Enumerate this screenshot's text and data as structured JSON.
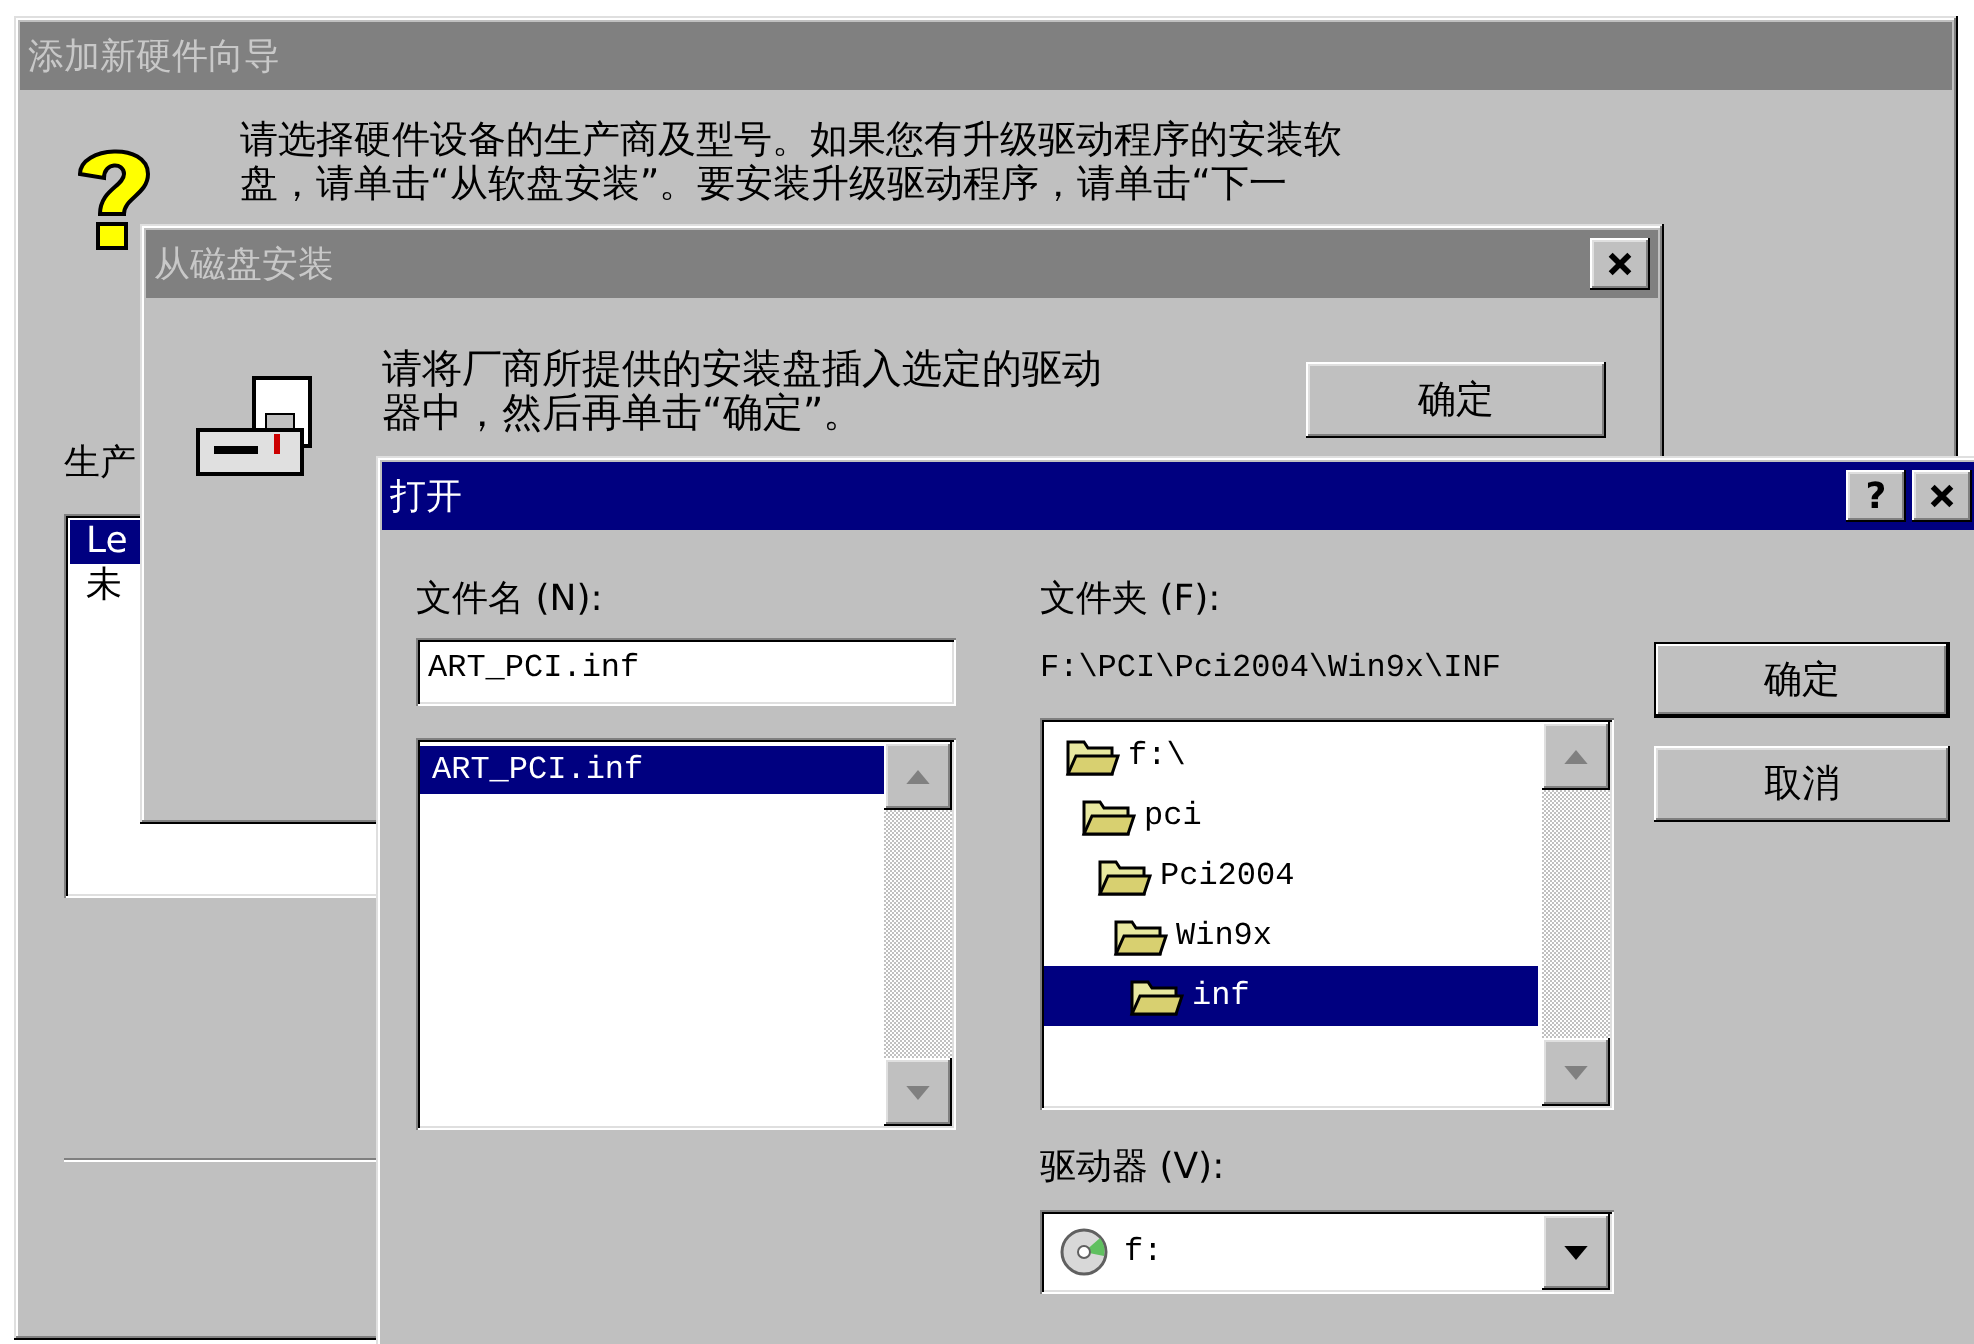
{
  "wizard": {
    "title": "添加新硬件向导",
    "active": false,
    "message": [
      "请选择硬件设备的生产商及型号。如果您有升级驱动程序的安装软",
      "盘，请单击“从软盘安装”。要安装升级驱动程序，请单击“下一"
    ],
    "manufacturer_label": "生产",
    "manufacturers": [
      {
        "label": "Le",
        "selected": true
      },
      {
        "label": "未",
        "selected": false
      }
    ]
  },
  "install_dialog": {
    "title": "从磁盘安装",
    "active": false,
    "message": [
      "请将厂商所提供的安装盘插入选定的驱动",
      "器中，然后再单击“确定”。"
    ],
    "ok_button": "确定"
  },
  "open_dialog": {
    "title": "打开",
    "active": true,
    "help_button": "?",
    "file_name_label": "文件名 (N):",
    "file_name": "ART_PCI.inf",
    "files": [
      {
        "label": "ART_PCI.inf",
        "selected": true
      }
    ],
    "folder_label": "文件夹 (F):",
    "folder_path": "F:\\PCI\\Pci2004\\Win9x\\INF",
    "folders": [
      {
        "label": "f:\\",
        "selected": false,
        "children": [
          {
            "label": "pci",
            "selected": false,
            "children": [
              {
                "label": "Pci2004",
                "selected": false,
                "children": [
                  {
                    "label": "Win9x",
                    "selected": false,
                    "children": [
                      {
                        "label": "inf",
                        "selected": true
                      }
                    ]
                  }
                ]
              }
            ]
          }
        ]
      }
    ],
    "drive_label": "驱动器 (V):",
    "drive": "f:",
    "buttons": [
      "确定",
      "取消"
    ]
  }
}
